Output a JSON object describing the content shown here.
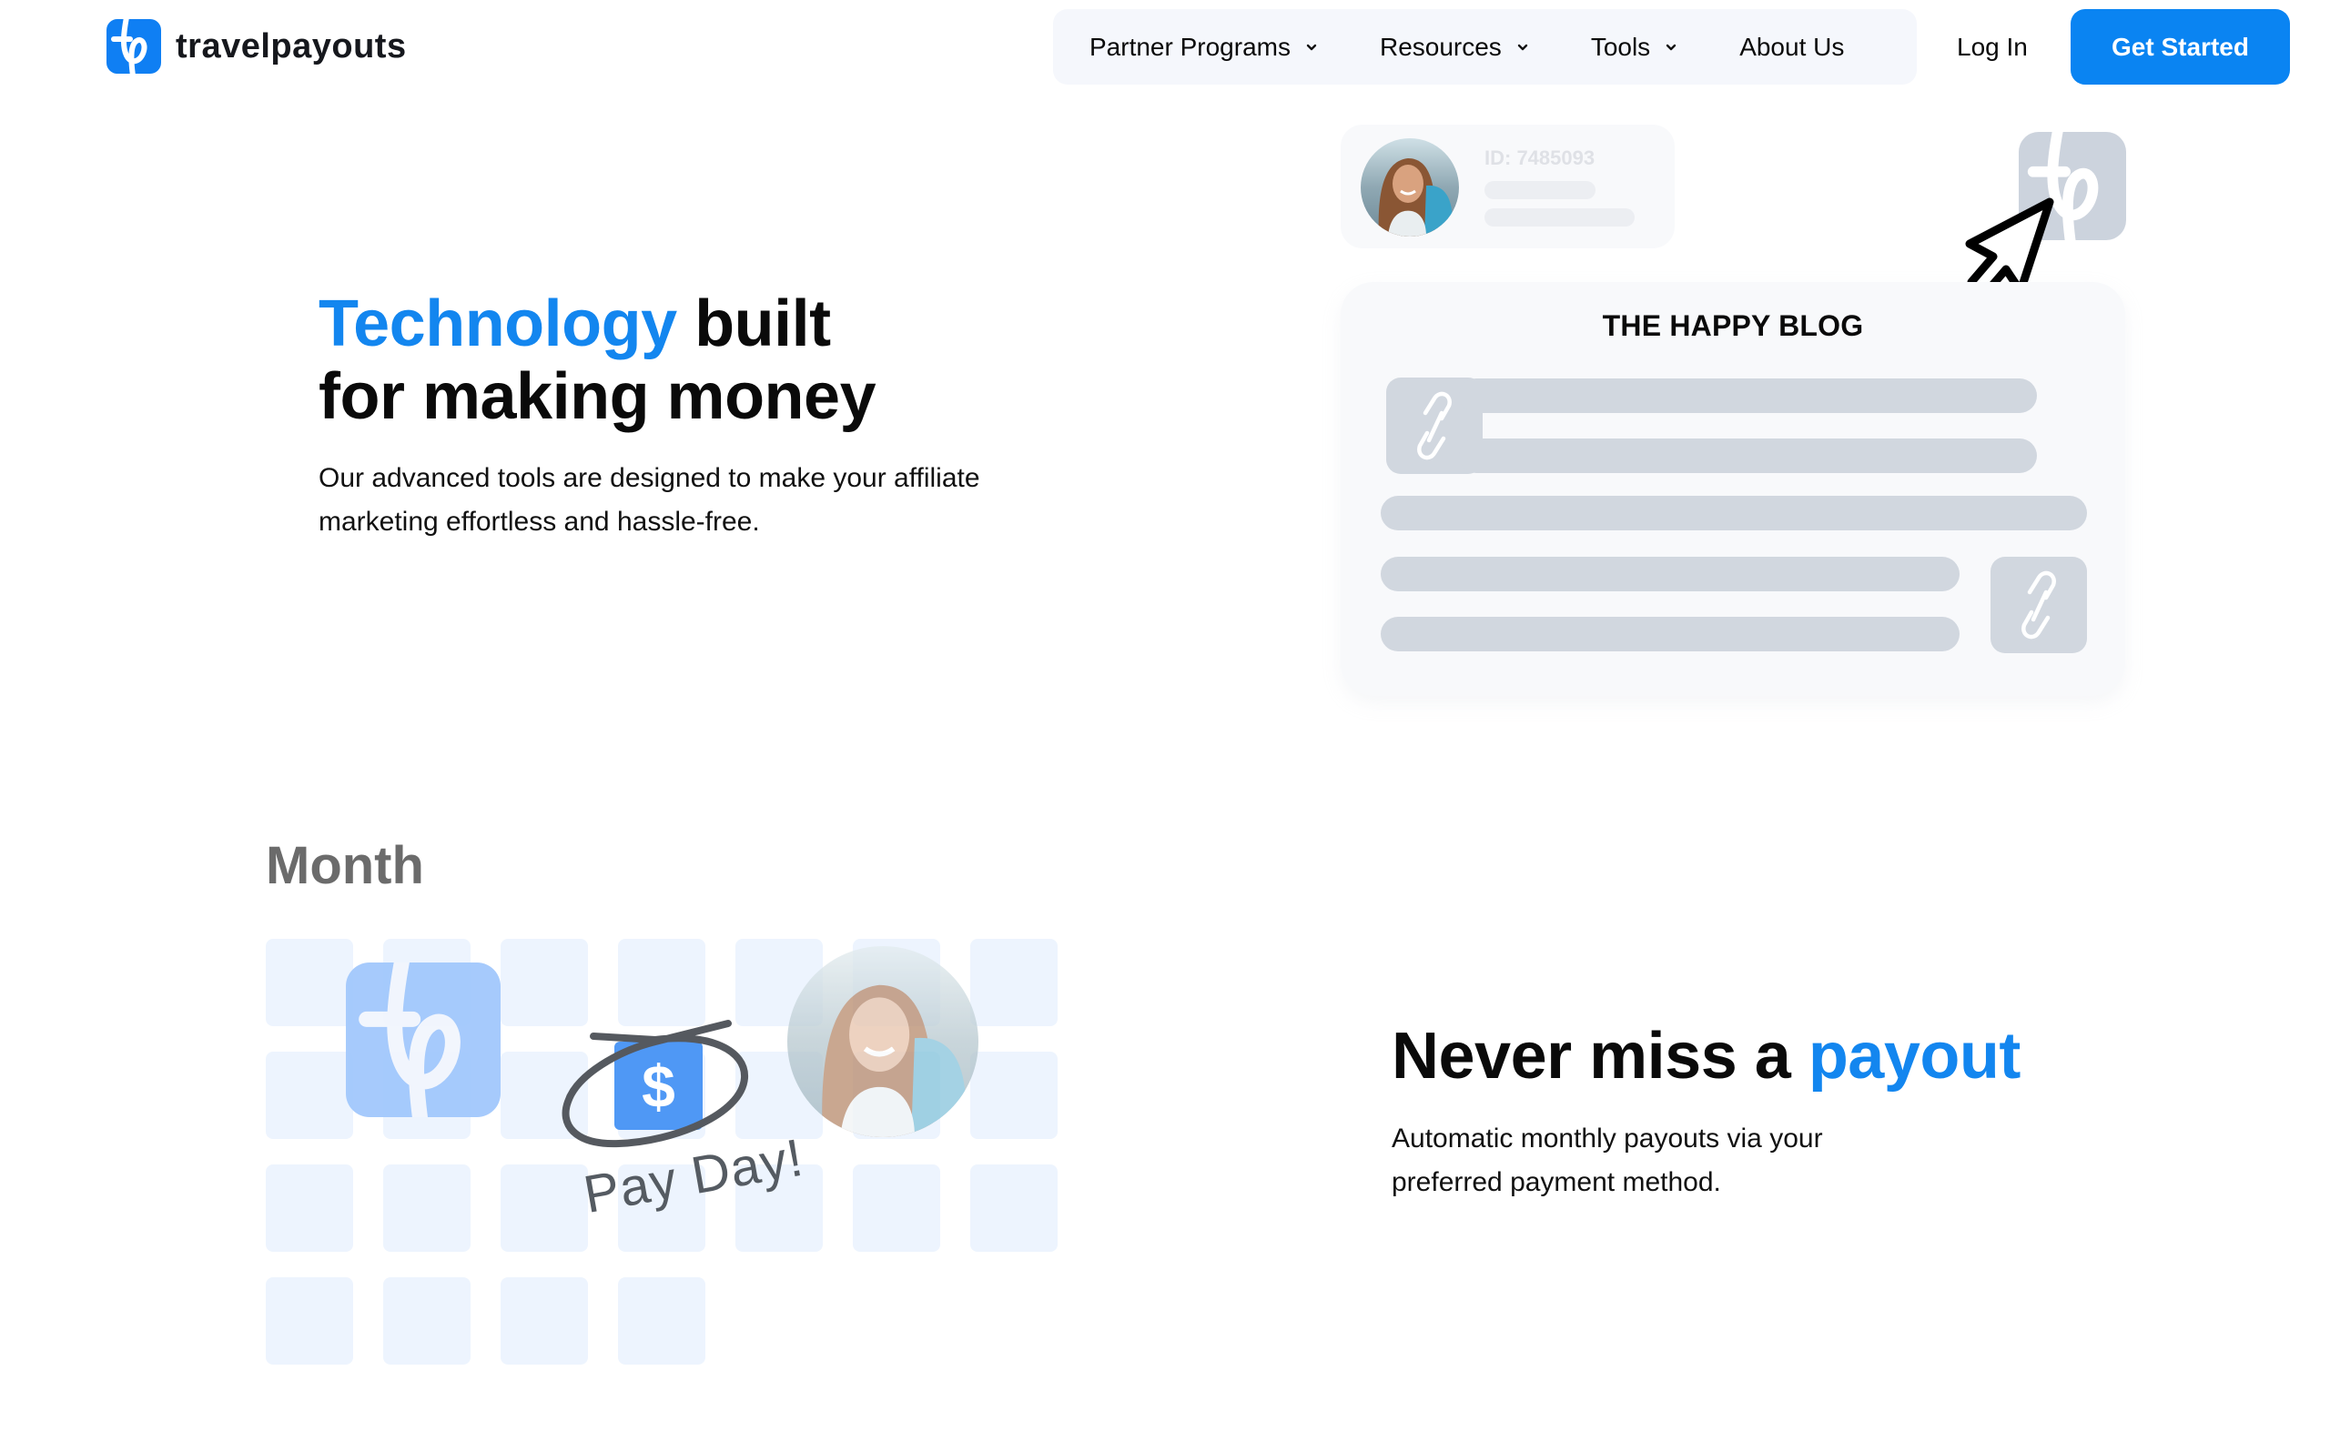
{
  "header": {
    "logo_text": "travelpayouts",
    "logo_icon": "tp-logo-icon",
    "nav": [
      {
        "label": "Partner Programs",
        "has_dropdown": true
      },
      {
        "label": "Resources",
        "has_dropdown": true
      },
      {
        "label": "Tools",
        "has_dropdown": true
      },
      {
        "label": "About Us",
        "has_dropdown": false
      }
    ],
    "login_label": "Log In",
    "cta_label": "Get Started"
  },
  "hero": {
    "title_accent": "Technology",
    "title_rest_line1": " built",
    "title_line2": "for making money",
    "text": "Our advanced tools are designed to make your affiliate marketing effortless and hassle-free."
  },
  "illustration": {
    "profile_id": "ID: 7485093",
    "blog_title": "THE HAPPY BLOG",
    "icons": [
      "avatar-photo",
      "tp-logo-icon",
      "cursor-arrow-icon",
      "link-icon",
      "link-icon"
    ]
  },
  "payout_section": {
    "calendar_label": "Month",
    "payday_label": "Pay Day!",
    "dollar_symbol": "$",
    "title_plain": "Never miss a ",
    "title_accent": "payout",
    "text": "Automatic monthly payouts via your preferred payment method."
  },
  "colors": {
    "brand_blue": "#0f7ff3",
    "accent_text": "#1386ef",
    "cta_bg": "#0a84f2",
    "nav_bg": "#f5f7fc",
    "skeleton": "#d1d7df",
    "calendar_cell": "#edf4fe"
  }
}
